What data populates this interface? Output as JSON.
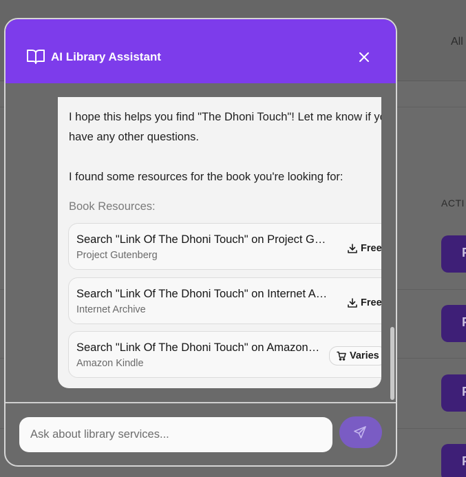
{
  "background": {
    "filter_label": "All",
    "actions_header": "ACTI",
    "action_button_glyph": "F"
  },
  "modal": {
    "title": "AI Library Assistant",
    "header_icon": "book-open-icon",
    "close_icon": "close-icon",
    "accent_color": "#7d3ceb"
  },
  "message": {
    "line1": "I hope this helps you find \"The Dhoni Touch\"! Let me know if you",
    "line2": "have any other questions.",
    "line3": "I found some resources for the book you're looking for:",
    "resources_heading": "Book Resources:"
  },
  "resources": [
    {
      "title": "Search \"Link Of The Dhoni Touch\" on Project Gutenberg",
      "source": "Project Gutenberg",
      "tag": "Free",
      "tag_icon": "download-icon"
    },
    {
      "title": "Search \"Link Of The Dhoni Touch\" on Internet Archive",
      "source": "Internet Archive",
      "tag": "Free",
      "tag_icon": "download-icon"
    },
    {
      "title": "Search \"Link Of The Dhoni Touch\" on Amazon Kindle",
      "source": "Amazon Kindle",
      "tag": "Varies",
      "tag_icon": "cart-icon"
    }
  ],
  "composer": {
    "placeholder": "Ask about library services...",
    "send_icon": "send-icon"
  }
}
